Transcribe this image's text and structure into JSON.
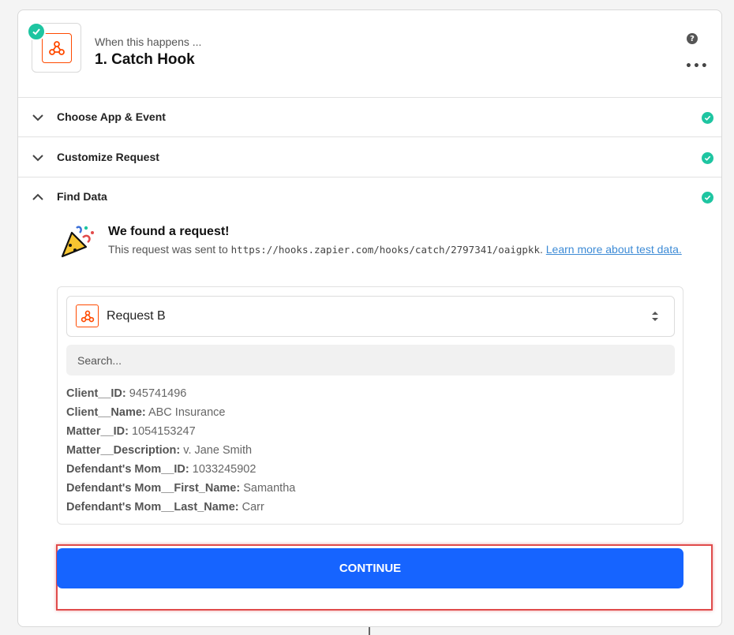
{
  "header": {
    "subtitle": "When this happens ...",
    "title": "1. Catch Hook",
    "help_glyph": "?",
    "more_glyph": "•••"
  },
  "sections": [
    {
      "label": "Choose App & Event",
      "expanded": false,
      "complete": true
    },
    {
      "label": "Customize Request",
      "expanded": false,
      "complete": true
    },
    {
      "label": "Find Data",
      "expanded": true,
      "complete": true
    }
  ],
  "found": {
    "title": "We found a request!",
    "desc_prefix": "This request was sent to ",
    "url": "https://hooks.zapier.com/hooks/catch/2797341/oaigpkk",
    "desc_suffix": ". ",
    "link": "Learn more about test data."
  },
  "request_select": {
    "value": "Request B"
  },
  "search": {
    "placeholder": "Search..."
  },
  "fields": [
    {
      "key": "Client__ID:",
      "value": "945741496"
    },
    {
      "key": "Client__Name:",
      "value": "ABC Insurance"
    },
    {
      "key": "Matter__ID:",
      "value": "1054153247"
    },
    {
      "key": "Matter__Description:",
      "value": "v. Jane Smith"
    },
    {
      "key": "Defendant's Mom__ID:",
      "value": "1033245902"
    },
    {
      "key": "Defendant's Mom__First_Name:",
      "value": "Samantha"
    },
    {
      "key": "Defendant's Mom__Last_Name:",
      "value": "Carr"
    }
  ],
  "continue_label": "CONTINUE",
  "colors": {
    "accent": "#1664ff",
    "brand": "#ff4a00",
    "success": "#1ec5a1",
    "highlight": "#e04b4b"
  }
}
